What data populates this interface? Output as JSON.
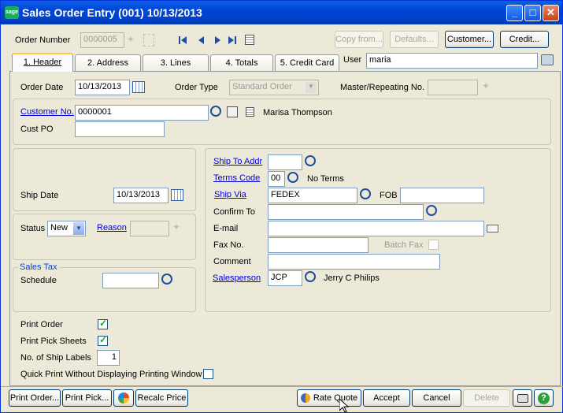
{
  "window": {
    "title": "Sales Order Entry (001) 10/13/2013",
    "logo_text": "sage"
  },
  "toolbar": {
    "order_number_label": "Order Number",
    "order_number_value": "0000005",
    "copy_from": "Copy from...",
    "defaults": "Defaults...",
    "customer": "Customer...",
    "credit": "Credit..."
  },
  "tabs": [
    {
      "label": "1. Header"
    },
    {
      "label": "2. Address"
    },
    {
      "label": "3. Lines"
    },
    {
      "label": "4. Totals"
    },
    {
      "label": "5. Credit Card"
    }
  ],
  "user": {
    "label": "User",
    "value": "maria"
  },
  "header": {
    "order_date_label": "Order Date",
    "order_date_value": "10/13/2013",
    "order_type_label": "Order Type",
    "order_type_value": "Standard Order",
    "master_label": "Master/Repeating No.",
    "master_value": "",
    "customer_no_label": "Customer No.",
    "customer_no_value": "0000001",
    "customer_name": "Marisa Thompson",
    "cust_po_label": "Cust PO",
    "cust_po_value": ""
  },
  "left": {
    "ship_date_label": "Ship Date",
    "ship_date_value": "10/13/2013",
    "status_label": "Status",
    "status_value": "New",
    "reason_label": "Reason",
    "reason_value": "",
    "sales_tax_group": "Sales Tax",
    "schedule_label": "Schedule",
    "schedule_value": ""
  },
  "right": {
    "ship_to_label": "Ship To Addr",
    "ship_to_value": "",
    "terms_label": "Terms Code",
    "terms_value": "00",
    "terms_desc": "No Terms",
    "ship_via_label": "Ship Via",
    "ship_via_value": "FEDEX",
    "fob_label": "FOB",
    "fob_value": "",
    "confirm_label": "Confirm To",
    "confirm_value": "",
    "email_label": "E-mail",
    "email_value": "",
    "fax_label": "Fax No.",
    "fax_value": "",
    "batch_fax_label": "Batch Fax",
    "comment_label": "Comment",
    "comment_value": "",
    "salesperson_label": "Salesperson",
    "salesperson_value": "JCP",
    "salesperson_name": "Jerry C Philips"
  },
  "print": {
    "print_order_label": "Print Order",
    "print_order_checked": true,
    "print_pick_label": "Print Pick Sheets",
    "print_pick_checked": true,
    "ship_labels_label": "No. of Ship Labels",
    "ship_labels_value": "1",
    "quick_print_label": "Quick Print Without Displaying Printing Window",
    "quick_print_checked": false
  },
  "footer": {
    "print_order": "Print Order...",
    "print_pick": "Print Pick...",
    "recalc": "Recalc Price",
    "rate_quote": "Rate Quote",
    "accept": "Accept",
    "cancel": "Cancel",
    "delete": "Delete"
  },
  "colors": {
    "titlebar": "#0045D5",
    "link": "#0000E0",
    "background": "#ECE9D8"
  }
}
